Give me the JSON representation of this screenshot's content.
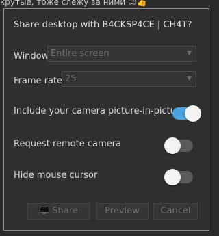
{
  "background": {
    "text": "крутые, тоже слежу за ними 😉👍"
  },
  "dialog": {
    "title": "Share desktop with B4CKSP4CE | CH4T?",
    "window": {
      "label": "Window:",
      "value": "Entire screen"
    },
    "frame_rate": {
      "label": "Frame rate:",
      "value": "25"
    },
    "toggles": [
      {
        "label": "Include your camera picture-in-picture",
        "on": true
      },
      {
        "label": "Request remote camera",
        "on": false
      },
      {
        "label": "Hide mouse cursor",
        "on": false
      }
    ],
    "buttons": {
      "share": "Share",
      "preview": "Preview",
      "cancel": "Cancel"
    },
    "colors": {
      "toggle_on": "#4aa3df",
      "toggle_off": "#5a5a5a"
    },
    "icons": {
      "share": "monitor-icon",
      "dropdown": "chevron-down-icon"
    }
  }
}
